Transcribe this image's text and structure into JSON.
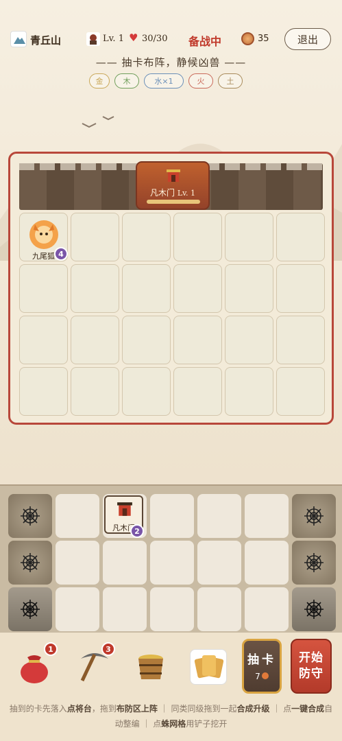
{
  "header": {
    "location_icon": "mountain-icon",
    "location": "青丘山",
    "level_icon": "warrior-avatar-icon",
    "level": "Lv. 1",
    "heart_icon": "heart-icon",
    "hp": "30/30",
    "status": "备战中",
    "coin_icon": "coin-icon",
    "coins": "35",
    "exit_label": "退出"
  },
  "subtitle": "—— 抽卡布阵，静候凶兽 ——",
  "elements": [
    {
      "label": "金",
      "color": "#c9a85a"
    },
    {
      "label": "木",
      "color": "#6f9e5a"
    },
    {
      "label": "水×1",
      "color": "#6a8fb8"
    },
    {
      "label": "火",
      "color": "#c96a5a"
    },
    {
      "label": "土",
      "color": "#a88a5a"
    }
  ],
  "battlefield": {
    "gate_name": "凡木门",
    "gate_level": "Lv. 1",
    "gate_icon": "gate-icon",
    "gate_hp": 1.0,
    "units": [
      {
        "row": 0,
        "col": 0,
        "name": "九尾狐",
        "icon": "fox-icon",
        "count": "4"
      }
    ]
  },
  "prep": {
    "card_name": "凡木门",
    "card_icon": "gate-icon",
    "card_count": "2"
  },
  "bottom": {
    "items": [
      {
        "icon": "bag-icon",
        "count": "1"
      },
      {
        "icon": "pickaxe-icon",
        "count": "3"
      },
      {
        "icon": "bucket-icon"
      }
    ],
    "cards_icon": "cards-icon",
    "draw_label": "抽卡",
    "draw_cost": "7",
    "start_line1": "开始",
    "start_line2": "防守"
  },
  "help": {
    "t1": "抽到的卡先落入",
    "t2": "点将台",
    "t3": "，拖到",
    "t4": "布防区上阵",
    "t5": " ｜ 同类同级拖到一起",
    "t6": "合成升级",
    "t7": " ｜ 点",
    "t8": "一键合成",
    "t9": "自动整编 ｜ 点",
    "t10": "蛛网格",
    "t11": "用铲子挖开"
  },
  "colors": {
    "accent_red": "#c0392b",
    "field_border": "#b8473a",
    "level_badge": "#7a55a8"
  }
}
